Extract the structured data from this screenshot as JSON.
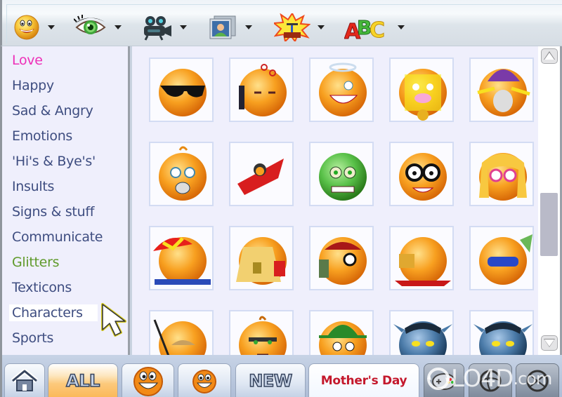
{
  "toolbar": {
    "buttons": [
      {
        "icon": "smiley-icon",
        "has_dropdown": true
      },
      {
        "icon": "eye-icon",
        "has_dropdown": true
      },
      {
        "icon": "video-camera-icon",
        "has_dropdown": true
      },
      {
        "icon": "photo-frame-icon",
        "has_dropdown": true
      },
      {
        "icon": "explosion-detonator-icon",
        "has_dropdown": true
      },
      {
        "icon": "abc-letters-icon",
        "has_dropdown": true
      }
    ]
  },
  "sidebar": {
    "items": [
      {
        "label": "Love",
        "color": "#ee2fb8"
      },
      {
        "label": "Happy",
        "color": "#3e4d80"
      },
      {
        "label": "Sad & Angry",
        "color": "#3e4d80"
      },
      {
        "label": "Emotions",
        "color": "#3e4d80"
      },
      {
        "label": "'Hi's & Bye's'",
        "color": "#3e4d80"
      },
      {
        "label": "Insults",
        "color": "#3e4d80"
      },
      {
        "label": "Signs & stuff",
        "color": "#3e4d80"
      },
      {
        "label": "Communicate",
        "color": "#3e4d80"
      },
      {
        "label": "Glitters",
        "color": "#5f9a2a"
      },
      {
        "label": "Texticons",
        "color": "#3e4d80"
      },
      {
        "label": "Characters",
        "color": "#3e4d80",
        "selected": true
      },
      {
        "label": "Sports",
        "color": "#3e4d80"
      }
    ]
  },
  "grid": {
    "emoticons": [
      "sunglasses-smiley",
      "drunk-bottle-smiley",
      "angel-smiley",
      "clown-medal-smiley",
      "wizard-lightning-smiley",
      "baby-pacifier-smiley",
      "pilot-airplane-smiley",
      "green-zombie-smiley",
      "nerd-glasses-smiley",
      "blonde-girl-smiley",
      "beach-umbrella-smiley",
      "sandcastle-smiley",
      "backpacker-smiley",
      "picnic-smiley",
      "snorkel-diver-smiley",
      "fisherman-smiley",
      "grumpy-orange-smiley",
      "green-hat-smiley",
      "avatar-navi-male",
      "avatar-navi-female"
    ]
  },
  "scrollbar": {
    "position_fraction": 0.62
  },
  "bottom_tabs": [
    {
      "type": "icon",
      "icon": "home-icon"
    },
    {
      "type": "text",
      "label": "ALL",
      "active": true
    },
    {
      "type": "icon",
      "icon": "big-grin-smiley-icon"
    },
    {
      "type": "icon",
      "icon": "small-grin-smiley-icon"
    },
    {
      "type": "text",
      "label": "NEW"
    },
    {
      "type": "text",
      "label": "Mother's Day"
    },
    {
      "type": "icon",
      "icon": "gamepad-icon"
    },
    {
      "type": "icon",
      "icon": "sport-ball-icon"
    },
    {
      "type": "icon",
      "icon": "sport-ball-icon-2"
    }
  ],
  "watermark": {
    "text": "LO4D",
    "suffix": ".com"
  }
}
